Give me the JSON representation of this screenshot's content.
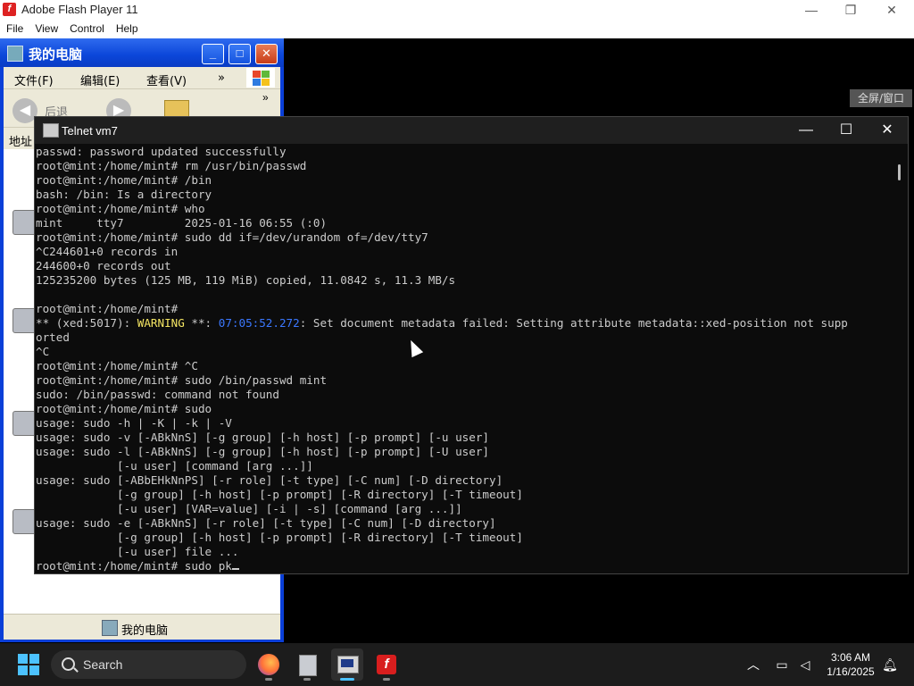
{
  "flash": {
    "title": "Adobe Flash Player 11",
    "menu": [
      "File",
      "View",
      "Control",
      "Help"
    ],
    "minimize": "—",
    "maximize": "❐",
    "close": "✕",
    "fullscreen_label": "全屏/窗口"
  },
  "xp": {
    "title": "我的电脑",
    "menu": [
      "文件(F)",
      "编辑(E)",
      "查看(V)",
      "»"
    ],
    "back_label": "后退",
    "toolbar_more": "»",
    "address_label": "地址",
    "status_text": "我的电脑",
    "btn_min": "_",
    "btn_max": "□",
    "btn_close": "✕"
  },
  "telnet": {
    "title": "Telnet vm7",
    "btn_min": "—",
    "btn_max": "☐",
    "btn_close": "✕",
    "lines": [
      "passwd: password updated successfully",
      "root@mint:/home/mint# rm /usr/bin/passwd",
      "root@mint:/home/mint# /bin",
      "bash: /bin: Is a directory",
      "root@mint:/home/mint# who",
      "mint     tty7         2025-01-16 06:55 (:0)",
      "root@mint:/home/mint# sudo dd if=/dev/urandom of=/dev/tty7",
      "^C244601+0 records in",
      "244600+0 records out",
      "125235200 bytes (125 MB, 119 MiB) copied, 11.0842 s, 11.3 MB/s",
      "",
      "root@mint:/home/mint#"
    ],
    "warning_prefix": "** (xed:5017): ",
    "warning_word": "WARNING",
    "warning_stars": " **: ",
    "warning_time": "07:05:52.272",
    "warning_rest": ": Set document metadata failed: Setting attribute metadata::xed-position not supp",
    "lines2": [
      "orted",
      "^C",
      "root@mint:/home/mint# ^C",
      "root@mint:/home/mint# sudo /bin/passwd mint",
      "sudo: /bin/passwd: command not found",
      "root@mint:/home/mint# sudo",
      "usage: sudo -h | -K | -k | -V",
      "usage: sudo -v [-ABkNnS] [-g group] [-h host] [-p prompt] [-u user]",
      "usage: sudo -l [-ABkNnS] [-g group] [-h host] [-p prompt] [-U user]",
      "            [-u user] [command [arg ...]]",
      "usage: sudo [-ABbEHkNnPS] [-r role] [-t type] [-C num] [-D directory]",
      "            [-g group] [-h host] [-p prompt] [-R directory] [-T timeout]",
      "            [-u user] [VAR=value] [-i | -s] [command [arg ...]]",
      "usage: sudo -e [-ABkNnS] [-r role] [-t type] [-C num] [-D directory]",
      "            [-g group] [-h host] [-p prompt] [-R directory] [-T timeout]",
      "            [-u user] file ..."
    ],
    "current_prompt": "root@mint:/home/mint# sudo pk"
  },
  "taskbar": {
    "search_label": "Search",
    "time": "3:06 AM",
    "date": "1/16/2025",
    "apps": [
      "firefox-icon",
      "file-manager-icon",
      "telnet-icon",
      "flash-player-icon"
    ],
    "tray": [
      "chevron-up-icon",
      "network-icon",
      "volume-icon",
      "notification-icon"
    ]
  },
  "colors": {
    "xp_title": "#0b46d9",
    "terminal_bg": "#0c0c0c",
    "warning": "#f5e663",
    "timestamp": "#3b78ff",
    "accent": "#4cc2ff"
  }
}
